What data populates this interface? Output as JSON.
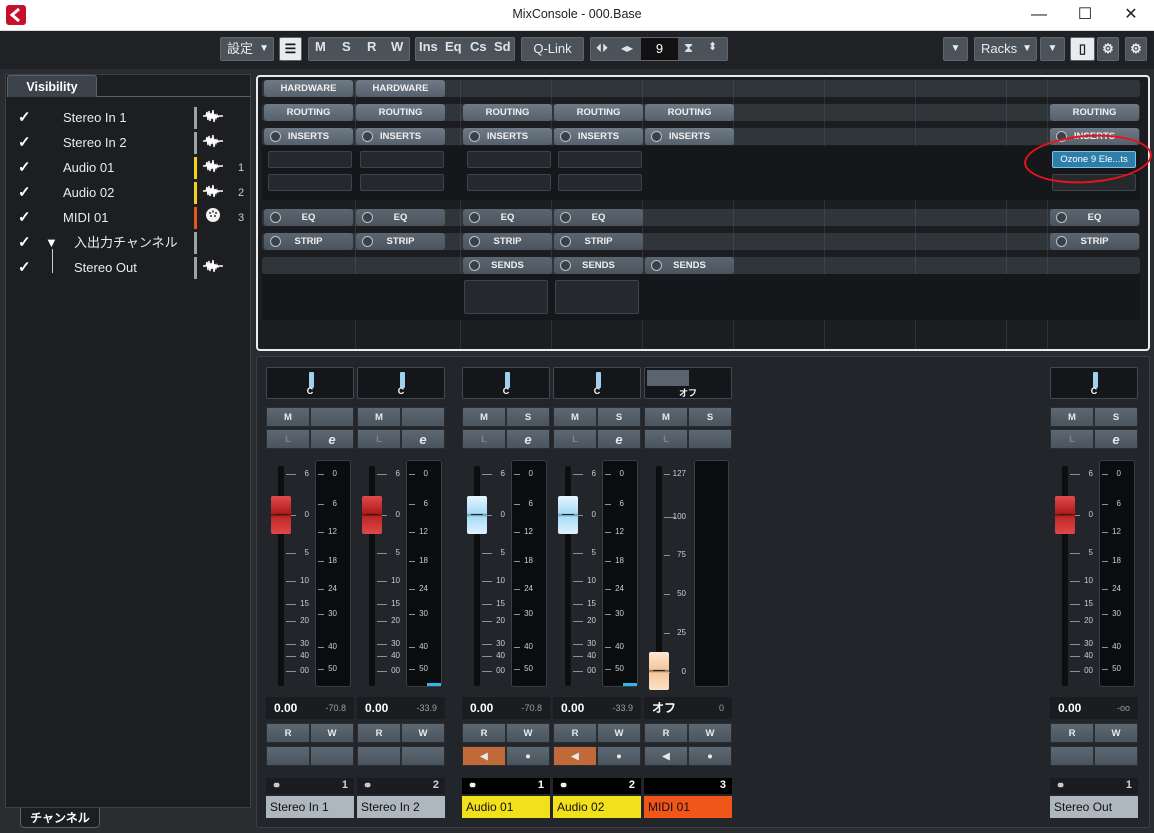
{
  "window": {
    "title": "MixConsole - 000.Base",
    "minimize": "—",
    "maximize": "☐",
    "close": "✕"
  },
  "toolbar": {
    "settings_label": "設定",
    "view_M": "M",
    "view_S": "S",
    "view_R": "R",
    "view_W": "W",
    "view_Ins": "Ins",
    "view_Eq": "Eq",
    "view_Cs": "Cs",
    "view_Sd": "Sd",
    "qlink": "Q-Link",
    "channel_count": "9",
    "racks_label": "Racks"
  },
  "left_panel": {
    "visibility_tab": "Visibility",
    "channels_tab": "チャンネル",
    "items": [
      {
        "check": "✓",
        "label": "Stereo In 1",
        "num": "",
        "color": "#9aa2aa"
      },
      {
        "check": "✓",
        "label": "Stereo In 2",
        "num": "",
        "color": "#9aa2aa"
      },
      {
        "check": "✓",
        "label": "Audio 01",
        "num": "1",
        "color": "#f2d21a"
      },
      {
        "check": "✓",
        "label": "Audio 02",
        "num": "2",
        "color": "#f2d21a"
      },
      {
        "check": "✓",
        "label": "MIDI 01",
        "num": "3",
        "color": "#e8561a"
      },
      {
        "check": "✓",
        "label": "入出力チャンネル",
        "num": "",
        "color": "#9aa2aa"
      },
      {
        "check": "✓",
        "label": "Stereo Out",
        "num": "",
        "color": "#9aa2aa"
      }
    ]
  },
  "racks": {
    "hardware": "HARDWARE",
    "routing": "ROUTING",
    "inserts": "INSERTS",
    "eq": "EQ",
    "strip": "STRIP",
    "sends": "SENDS",
    "plugin_slot": "Ozone 9 Ele...ts"
  },
  "channels": [
    {
      "name": "Stereo In 1",
      "pan": "C",
      "m": "M",
      "s": "",
      "vol": "0.00",
      "peak": "-70.8",
      "num": "1",
      "color": "#aeb6be",
      "fader": "red",
      "scale": [
        "6",
        "0",
        "5",
        "10",
        "15",
        "20",
        "30",
        "40",
        "00"
      ],
      "meter": [
        "0",
        "6",
        "12",
        "18",
        "24",
        "30",
        "40",
        "50"
      ],
      "r": "R",
      "w": "W"
    },
    {
      "name": "Stereo In 2",
      "pan": "C",
      "m": "M",
      "s": "",
      "vol": "0.00",
      "peak": "-33.9",
      "num": "2",
      "color": "#aeb6be",
      "fader": "red",
      "scale": [
        "6",
        "0",
        "5",
        "10",
        "15",
        "20",
        "30",
        "40",
        "00"
      ],
      "meter": [
        "0",
        "6",
        "12",
        "18",
        "24",
        "30",
        "40",
        "50"
      ],
      "r": "R",
      "w": "W"
    },
    {
      "name": "Audio 01",
      "pan": "C",
      "m": "M",
      "s": "S",
      "vol": "0.00",
      "peak": "-70.8",
      "num": "1",
      "color": "#f2e01a",
      "fader": "blue",
      "scale": [
        "6",
        "0",
        "5",
        "10",
        "15",
        "20",
        "30",
        "40",
        "00"
      ],
      "meter": [
        "0",
        "6",
        "12",
        "18",
        "24",
        "30",
        "40",
        "50"
      ],
      "r": "R",
      "w": "W"
    },
    {
      "name": "Audio 02",
      "pan": "C",
      "m": "M",
      "s": "S",
      "vol": "0.00",
      "peak": "-33.9",
      "num": "2",
      "color": "#f2e01a",
      "fader": "blue",
      "scale": [
        "6",
        "0",
        "5",
        "10",
        "15",
        "20",
        "30",
        "40",
        "00"
      ],
      "meter": [
        "0",
        "6",
        "12",
        "18",
        "24",
        "30",
        "40",
        "50"
      ],
      "r": "R",
      "w": "W"
    },
    {
      "name": "MIDI 01",
      "pan": "オフ",
      "m": "M",
      "s": "S",
      "vol": "オフ",
      "peak": "0",
      "num": "3",
      "color": "#f0561a",
      "fader": "peach",
      "scale": [
        "127",
        "100",
        "75",
        "50",
        "25",
        "0"
      ],
      "meter": [],
      "r": "R",
      "w": "W"
    },
    {
      "name": "Stereo Out",
      "pan": "C",
      "m": "M",
      "s": "S",
      "vol": "0.00",
      "peak": "-oo",
      "num": "1",
      "color": "#aeb6be",
      "fader": "red",
      "scale": [
        "6",
        "0",
        "5",
        "10",
        "15",
        "20",
        "30",
        "40",
        "00"
      ],
      "meter": [
        "0",
        "6",
        "12",
        "18",
        "24",
        "30",
        "40",
        "50"
      ],
      "r": "R",
      "w": "W"
    }
  ]
}
